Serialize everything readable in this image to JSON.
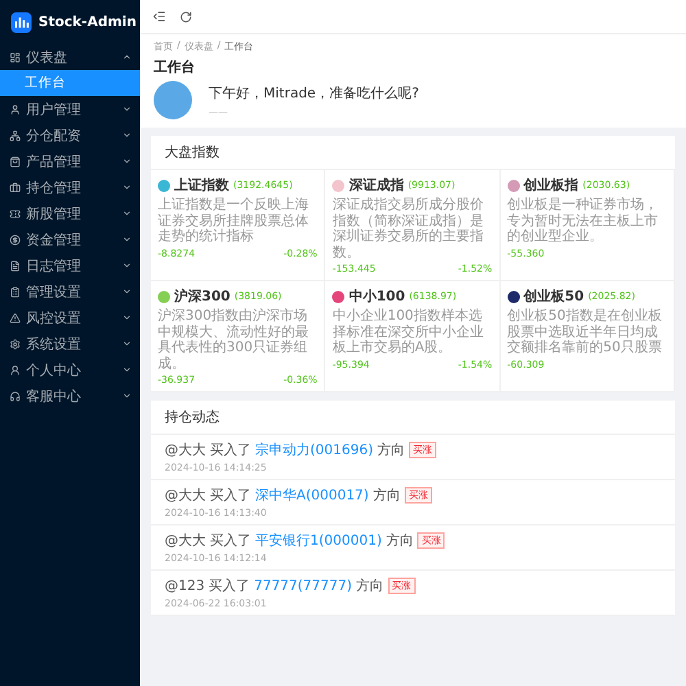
{
  "sidebar": {
    "brand": "Stock-Admin",
    "items": [
      {
        "label": "仪表盘",
        "kind": "dashboard",
        "expanded": true,
        "children": [
          {
            "label": "工作台",
            "selected": true
          }
        ]
      },
      {
        "label": "用户管理",
        "kind": "user",
        "expanded": false
      },
      {
        "label": "分仓配资",
        "kind": "split",
        "expanded": false
      },
      {
        "label": "产品管理",
        "kind": "product",
        "expanded": false
      },
      {
        "label": "持仓管理",
        "kind": "hold",
        "expanded": false
      },
      {
        "label": "新股管理",
        "kind": "ipo",
        "expanded": false
      },
      {
        "label": "资金管理",
        "kind": "money",
        "expanded": false
      },
      {
        "label": "日志管理",
        "kind": "log",
        "expanded": false
      },
      {
        "label": "管理设置",
        "kind": "admin",
        "expanded": false
      },
      {
        "label": "风控设置",
        "kind": "risk",
        "expanded": false
      },
      {
        "label": "系统设置",
        "kind": "system",
        "expanded": false
      },
      {
        "label": "个人中心",
        "kind": "person",
        "expanded": false
      },
      {
        "label": "客服中心",
        "kind": "service",
        "expanded": false
      }
    ]
  },
  "breadcrumbs": {
    "items": [
      "首页",
      "仪表盘",
      "工作台"
    ],
    "separators": [
      "/",
      "/"
    ]
  },
  "page_title": "工作台",
  "greeting": {
    "text": "下午好，Mitrade，准备吃什么呢?",
    "subtext": "——"
  },
  "indices": {
    "title": "大盘指数",
    "cards": [
      {
        "name": "上证指数",
        "value": "(3192.4645)",
        "color": "#3bb7d6",
        "description": "上证指数是一个反映上海证券交易所挂牌股票总体走势的统计指标",
        "change": "-8.8274",
        "percent": "-0.28%"
      },
      {
        "name": "深证成指",
        "value": "(9913.07)",
        "color": "#f3c4cb",
        "description": "深证成指交易所成分股价指数（简称深证成指）是深圳证券交易所的主要指数。",
        "change": "-153.445",
        "percent": "-1.52%"
      },
      {
        "name": "创业板指",
        "value": "(2030.63)",
        "color": "#d59ab6",
        "description": "创业板是一种证券市场，专为暂时无法在主板上市的创业型企业。",
        "change": "-55.360"
      },
      {
        "name": "沪深300",
        "value": "(3819.06)",
        "color": "#86cf55",
        "description": "沪深300指数由沪深市场中规模大、流动性好的最具代表性的300只证券组成。",
        "change": "-36.937",
        "percent": "-0.36%"
      },
      {
        "name": "中小100",
        "value": "(6138.97)",
        "color": "#e4467b",
        "description": "中小企业100指数样本选择标准在深交所中小企业板上市交易的A股。",
        "change": "-95.394",
        "percent": "-1.54%"
      },
      {
        "name": "创业板50",
        "value": "(2025.82)",
        "color": "#1e2a6a",
        "description": "创业板50指数是在创业板股票中选取近半年日均成交额排名靠前的50只股票",
        "change": "-60.309"
      }
    ]
  },
  "holdings": {
    "title": "持仓动态",
    "items": [
      {
        "user": "@大大",
        "action": "买入了",
        "stock": "宗申动力(001696)",
        "direction": "方向",
        "tag": "买涨",
        "time": "2024-10-16 14:14:25"
      },
      {
        "user": "@大大",
        "action": "买入了",
        "stock": "深中华A(000017)",
        "direction": "方向",
        "tag": "买涨",
        "time": "2024-10-16 14:13:40"
      },
      {
        "user": "@大大",
        "action": "买入了",
        "stock": "平安银行1(000001)",
        "direction": "方向",
        "tag": "买涨",
        "time": "2024-10-16 14:12:14"
      },
      {
        "user": "@123",
        "action": "买入了",
        "stock": "77777(77777)",
        "direction": "方向",
        "tag": "买涨",
        "time": "2024-06-22 16:03:01"
      }
    ]
  }
}
